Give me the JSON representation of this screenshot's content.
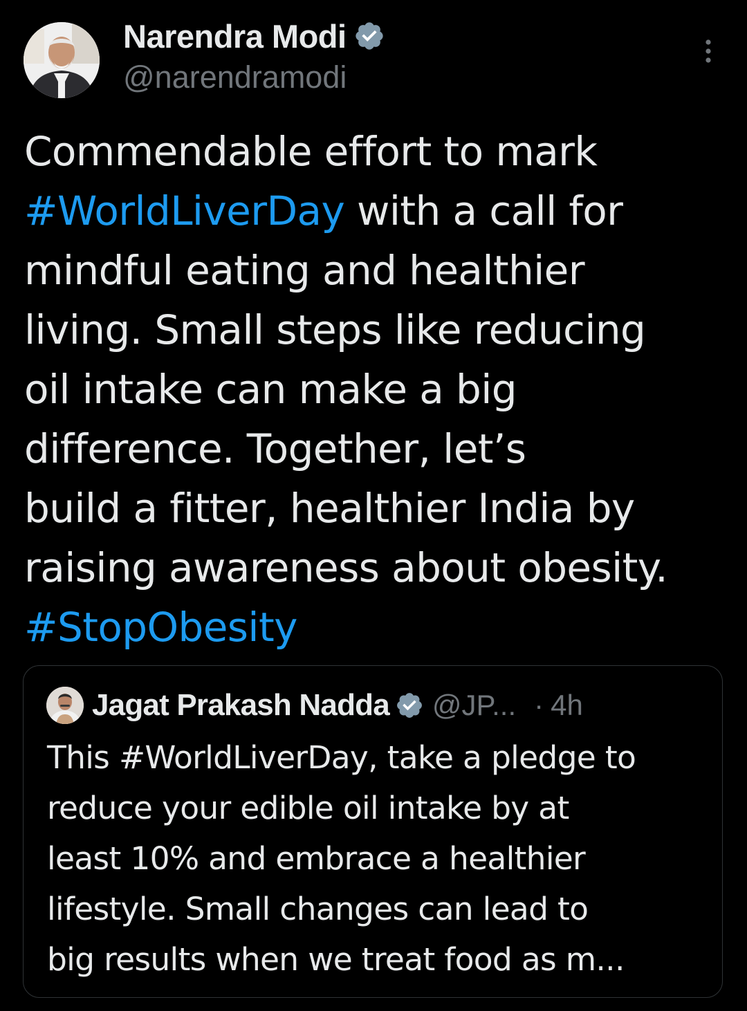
{
  "author": {
    "display_name": "Narendra Modi",
    "handle": "@narendramodi",
    "verified": true,
    "avatar_icon": "profile-photo-avatar",
    "more_icon": "more-vertical-icon"
  },
  "tweet": {
    "lines": [
      [
        {
          "text": "Commendable effort to mark",
          "kind": "text"
        }
      ],
      [
        {
          "text": "#WorldLiverDay",
          "kind": "hashtag"
        },
        {
          "text": " with a call for",
          "kind": "text"
        }
      ],
      [
        {
          "text": "mindful eating and healthier",
          "kind": "text"
        }
      ],
      [
        {
          "text": "living. Small steps like reducing",
          "kind": "text"
        }
      ],
      [
        {
          "text": "oil intake can make a big",
          "kind": "text"
        }
      ],
      [
        {
          "text": "difference.  Together, let’s",
          "kind": "text"
        }
      ],
      [
        {
          "text": "build a fitter, healthier India by",
          "kind": "text"
        }
      ],
      [
        {
          "text": "raising awareness about obesity.",
          "kind": "text"
        }
      ],
      [
        {
          "text": "#StopObesity",
          "kind": "hashtag"
        }
      ]
    ]
  },
  "quote": {
    "display_name": "Jagat Prakash Nadda",
    "handle": "@JP...",
    "separator": "·",
    "time": "4h",
    "verified": true,
    "lines": [
      "This #WorldLiverDay, take a pledge to",
      "reduce your edible oil intake by at",
      "least 10% and embrace a healthier",
      "lifestyle. Small changes can lead to",
      "big results when we treat food as m..."
    ]
  },
  "colors": {
    "background": "#000000",
    "text_primary": "#e7e9ea",
    "text_secondary": "#71767b",
    "link": "#1d9bf0",
    "badge": "#829aab",
    "border": "#2f3336"
  }
}
